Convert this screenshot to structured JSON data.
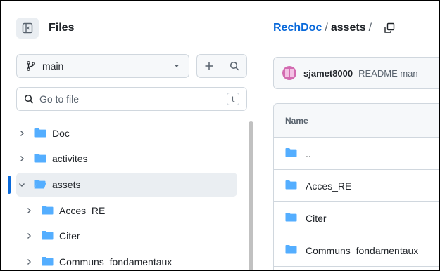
{
  "sidebar": {
    "title": "Files",
    "branch": "main",
    "goto_placeholder": "Go to file",
    "goto_shortcut": "t",
    "tree": [
      {
        "label": "Doc",
        "expanded": false,
        "selected": false
      },
      {
        "label": "activites",
        "expanded": false,
        "selected": false
      },
      {
        "label": "assets",
        "expanded": true,
        "selected": true
      },
      {
        "label": "Acces_RE",
        "expanded": false,
        "selected": false
      },
      {
        "label": "Citer",
        "expanded": false,
        "selected": false
      },
      {
        "label": "Communs_fondamentaux",
        "expanded": false,
        "selected": false
      }
    ]
  },
  "breadcrumb": {
    "repo": "RechDoc",
    "sep1": "/",
    "current": "assets",
    "sep2": "/"
  },
  "commit": {
    "author": "sjamet8000",
    "message": "README man"
  },
  "table": {
    "header": "Name",
    "rows": [
      {
        "name": ".."
      },
      {
        "name": "Acces_RE"
      },
      {
        "name": "Citer"
      },
      {
        "name": "Communs_fondamentaux"
      }
    ]
  },
  "colors": {
    "accent": "#0969da",
    "folder": "#54aeff",
    "border": "#d0d7de",
    "muted": "#59636e"
  }
}
